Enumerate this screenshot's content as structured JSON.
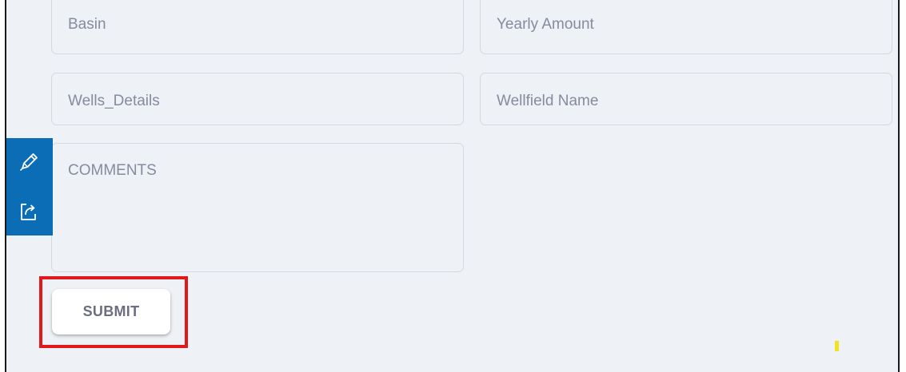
{
  "form": {
    "fields": {
      "basin": {
        "placeholder": "Basin"
      },
      "yearly_amount": {
        "placeholder": "Yearly Amount"
      },
      "wells_details": {
        "placeholder": "Wells_Details"
      },
      "wellfield_name": {
        "placeholder": "Wellfield Name"
      },
      "comments": {
        "placeholder": "COMMENTS"
      }
    },
    "submit_label": "SUBMIT"
  },
  "side_toolbar": {
    "items": [
      {
        "icon": "pencil-icon"
      },
      {
        "icon": "share-icon"
      }
    ]
  },
  "colors": {
    "background": "#eef1f5",
    "field_border": "#d4d8df",
    "placeholder_text": "#868b9e",
    "toolbar_blue": "#0a6db5",
    "highlight_red": "#e01a1a",
    "marker_yellow": "#f2e21c"
  }
}
